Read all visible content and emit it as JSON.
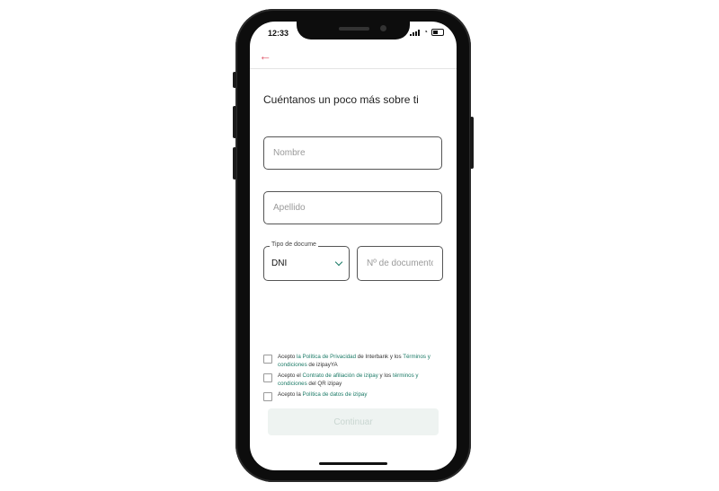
{
  "status": {
    "time": "12:33"
  },
  "form": {
    "title": "Cuéntanos un poco más sobre ti",
    "nombre_placeholder": "Nombre",
    "apellido_placeholder": "Apellido",
    "doc_type_label": "Tipo de docume",
    "doc_type_value": "DNI",
    "doc_number_placeholder": "Nº de documento"
  },
  "consents": [
    {
      "t1": "Acepto ",
      "l1": "la Política de Privacidad",
      "t2": " de Interbank y los ",
      "l2": "Términos y condiciones",
      "t3": " de izipayYA"
    },
    {
      "t1": "Acepto el ",
      "l1": "Contrato de afiliación de izipay",
      "t2": " y los ",
      "l2": "términos y condiciones",
      "t3": " del QR izipay"
    },
    {
      "t1": "Acepto la ",
      "l1": "Política de datos de izipay",
      "t2": "",
      "l2": "",
      "t3": ""
    }
  ],
  "button": {
    "continue_label": "Continuar"
  },
  "colors": {
    "accent": "#1b7a66",
    "back_arrow": "#e0566a",
    "button_bg": "#eef3f1"
  },
  "icons": {
    "back": "arrow-left-icon",
    "dropdown": "chevron-down-icon"
  }
}
